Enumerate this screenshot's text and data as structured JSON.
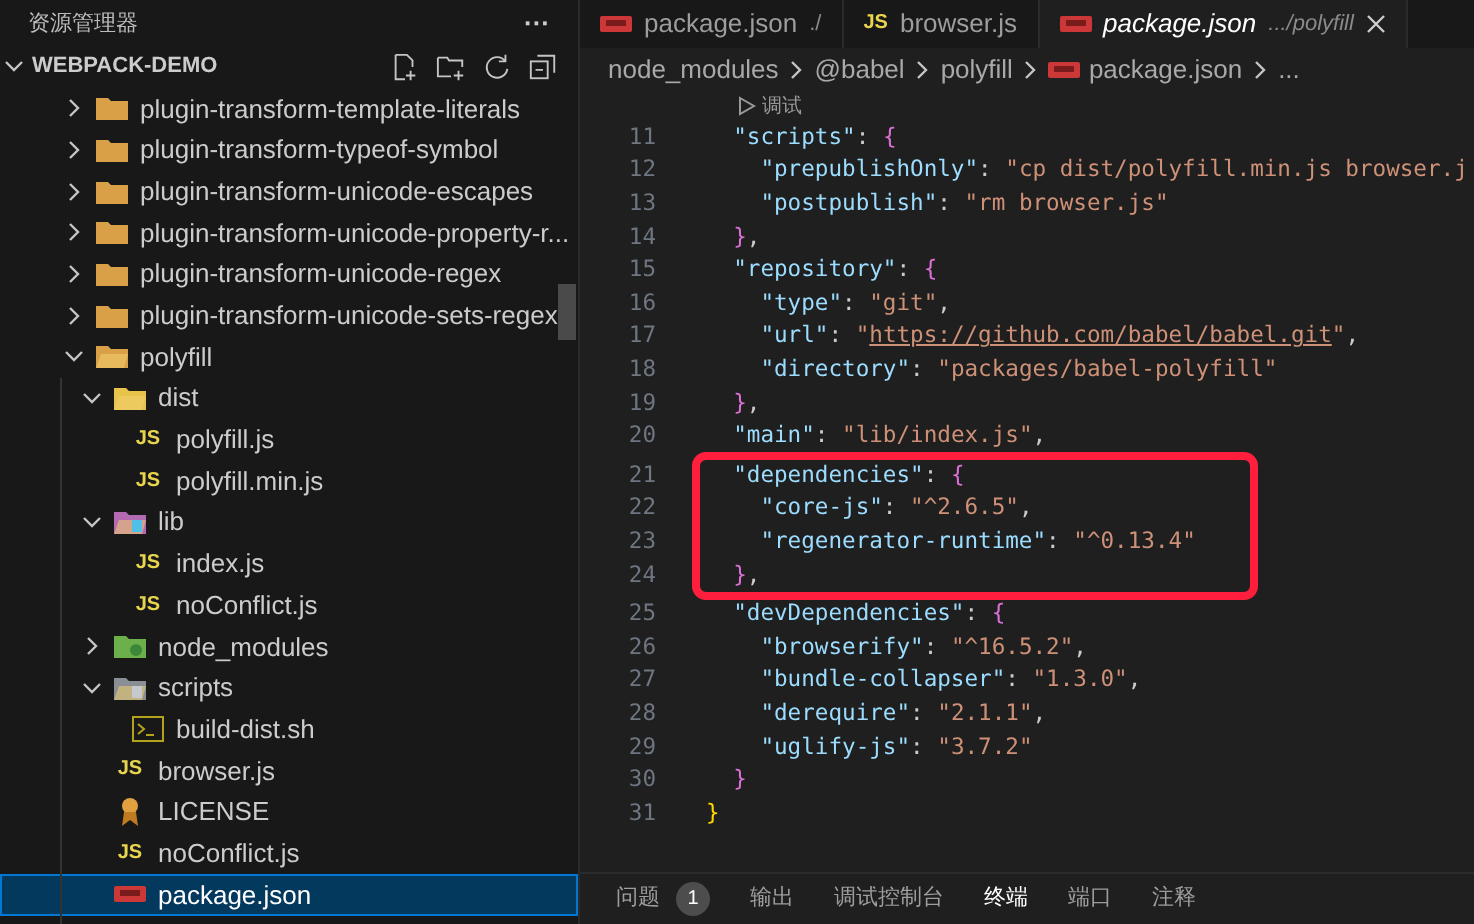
{
  "sidebar": {
    "title": "资源管理器",
    "more": "···",
    "project": {
      "name": "WEBPACK-DEMO",
      "expanded": true
    },
    "tree": [
      {
        "name": "plugin-transform-template-literals",
        "kind": "folder",
        "expanded": false,
        "selected": false
      },
      {
        "name": "plugin-transform-typeof-symbol",
        "kind": "folder",
        "expanded": false,
        "selected": false
      },
      {
        "name": "plugin-transform-unicode-escapes",
        "kind": "folder",
        "expanded": false,
        "selected": false
      },
      {
        "name": "plugin-transform-unicode-property-r...",
        "kind": "folder",
        "expanded": false,
        "selected": false
      },
      {
        "name": "plugin-transform-unicode-regex",
        "kind": "folder",
        "expanded": false,
        "selected": false
      },
      {
        "name": "plugin-transform-unicode-sets-regex",
        "kind": "folder",
        "expanded": false,
        "selected": false
      },
      {
        "name": "polyfill",
        "kind": "folder",
        "expanded": true,
        "selected": false,
        "children": [
          {
            "name": "dist",
            "kind": "dist",
            "expanded": true,
            "selected": false,
            "children": [
              {
                "name": "polyfill.js",
                "kind": "js",
                "icon_label": "JS",
                "selected": false
              },
              {
                "name": "polyfill.min.js",
                "kind": "js",
                "icon_label": "JS",
                "selected": false
              }
            ]
          },
          {
            "name": "lib",
            "kind": "lib",
            "expanded": true,
            "selected": false,
            "children": [
              {
                "name": "index.js",
                "kind": "js",
                "icon_label": "JS",
                "selected": false
              },
              {
                "name": "noConflict.js",
                "kind": "js",
                "icon_label": "JS",
                "selected": false
              }
            ]
          },
          {
            "name": "node_modules",
            "kind": "node",
            "expanded": false,
            "selected": false
          },
          {
            "name": "scripts",
            "kind": "scripts",
            "expanded": true,
            "selected": false,
            "children": [
              {
                "name": "build-dist.sh",
                "kind": "shell",
                "selected": false
              }
            ]
          },
          {
            "name": "browser.js",
            "kind": "js",
            "icon_label": "JS",
            "selected": false
          },
          {
            "name": "LICENSE",
            "kind": "license",
            "selected": false
          },
          {
            "name": "noConflict.js",
            "kind": "js",
            "icon_label": "JS",
            "selected": false
          },
          {
            "name": "package.json",
            "kind": "json",
            "selected": true
          }
        ]
      }
    ]
  },
  "tabs": [
    {
      "label": "package.json",
      "detail": "./",
      "kind": "json",
      "selected": false
    },
    {
      "label": "browser.js",
      "kind": "js",
      "icon_label": "JS",
      "selected": false
    },
    {
      "label": "package.json",
      "detail": ".../polyfill",
      "kind": "json",
      "selected": true
    }
  ],
  "breadcrumb": [
    {
      "label": "node_modules",
      "kind": "folder"
    },
    {
      "label": "@babel",
      "kind": "folder"
    },
    {
      "label": "polyfill",
      "kind": "folder"
    },
    {
      "label": "package.json",
      "kind": "json"
    },
    {
      "label": "...",
      "kind": "folder"
    }
  ],
  "codelens": "调试",
  "lines": [
    {
      "number": "11",
      "highlighted": false,
      "tokens": [
        {
          "kind": "key",
          "text": "  \"scripts\""
        },
        {
          "kind": "punct",
          "text": ": "
        },
        {
          "kind": "brace",
          "text": "{"
        }
      ]
    },
    {
      "number": "12",
      "highlighted": false,
      "tokens": [
        {
          "kind": "key",
          "text": "    \"prepublishOnly\""
        },
        {
          "kind": "punct",
          "text": ": "
        },
        {
          "kind": "string",
          "text": "\"cp dist/polyfill.min.js browser.j"
        }
      ]
    },
    {
      "number": "13",
      "highlighted": false,
      "tokens": [
        {
          "kind": "key",
          "text": "    \"postpublish\""
        },
        {
          "kind": "punct",
          "text": ": "
        },
        {
          "kind": "string",
          "text": "\"rm browser.js\""
        }
      ]
    },
    {
      "number": "14",
      "highlighted": false,
      "tokens": [
        {
          "kind": "brace",
          "text": "  }"
        },
        {
          "kind": "punct",
          "text": ","
        }
      ]
    },
    {
      "number": "15",
      "highlighted": false,
      "tokens": [
        {
          "kind": "key",
          "text": "  \"repository\""
        },
        {
          "kind": "punct",
          "text": ": "
        },
        {
          "kind": "brace",
          "text": "{"
        }
      ]
    },
    {
      "number": "16",
      "highlighted": false,
      "tokens": [
        {
          "kind": "key",
          "text": "    \"type\""
        },
        {
          "kind": "punct",
          "text": ": "
        },
        {
          "kind": "string",
          "text": "\"git\""
        },
        {
          "kind": "punct",
          "text": ","
        }
      ]
    },
    {
      "number": "17",
      "highlighted": false,
      "tokens": [
        {
          "kind": "key",
          "text": "    \"url\""
        },
        {
          "kind": "punct",
          "text": ": "
        },
        {
          "kind": "string",
          "text": "\""
        },
        {
          "kind": "link",
          "text": "https://github.com/babel/babel.git"
        },
        {
          "kind": "string",
          "text": "\""
        },
        {
          "kind": "punct",
          "text": ","
        }
      ]
    },
    {
      "number": "18",
      "highlighted": false,
      "tokens": [
        {
          "kind": "key",
          "text": "    \"directory\""
        },
        {
          "kind": "punct",
          "text": ": "
        },
        {
          "kind": "string",
          "text": "\"packages/babel-polyfill\""
        }
      ]
    },
    {
      "number": "19",
      "highlighted": false,
      "tokens": [
        {
          "kind": "brace",
          "text": "  }"
        },
        {
          "kind": "punct",
          "text": ","
        }
      ]
    },
    {
      "number": "20",
      "highlighted": false,
      "tokens": [
        {
          "kind": "key",
          "text": "  \"main\""
        },
        {
          "kind": "punct",
          "text": ": "
        },
        {
          "kind": "string",
          "text": "\"lib/index.js\""
        },
        {
          "kind": "punct",
          "text": ","
        }
      ]
    },
    {
      "number": "21",
      "highlighted": true,
      "tokens": [
        {
          "kind": "key",
          "text": "  \"dependencies\""
        },
        {
          "kind": "punct",
          "text": ": "
        },
        {
          "kind": "brace",
          "text": "{"
        }
      ]
    },
    {
      "number": "22",
      "highlighted": true,
      "tokens": [
        {
          "kind": "key",
          "text": "    \"core-js\""
        },
        {
          "kind": "punct",
          "text": ": "
        },
        {
          "kind": "string",
          "text": "\"^2.6.5\""
        },
        {
          "kind": "punct",
          "text": ","
        }
      ]
    },
    {
      "number": "23",
      "highlighted": true,
      "tokens": [
        {
          "kind": "key",
          "text": "    \"regenerator-runtime\""
        },
        {
          "kind": "punct",
          "text": ": "
        },
        {
          "kind": "string",
          "text": "\"^0.13.4\""
        }
      ]
    },
    {
      "number": "24",
      "highlighted": true,
      "tokens": [
        {
          "kind": "brace",
          "text": "  }"
        },
        {
          "kind": "punct",
          "text": ","
        }
      ]
    },
    {
      "number": "25",
      "highlighted": false,
      "tokens": [
        {
          "kind": "key",
          "text": "  \"devDependencies\""
        },
        {
          "kind": "punct",
          "text": ": "
        },
        {
          "kind": "brace",
          "text": "{"
        }
      ]
    },
    {
      "number": "26",
      "highlighted": false,
      "tokens": [
        {
          "kind": "key",
          "text": "    \"browserify\""
        },
        {
          "kind": "punct",
          "text": ": "
        },
        {
          "kind": "string",
          "text": "\"^16.5.2\""
        },
        {
          "kind": "punct",
          "text": ","
        }
      ]
    },
    {
      "number": "27",
      "highlighted": false,
      "tokens": [
        {
          "kind": "key",
          "text": "    \"bundle-collapser\""
        },
        {
          "kind": "punct",
          "text": ": "
        },
        {
          "kind": "string",
          "text": "\"1.3.0\""
        },
        {
          "kind": "punct",
          "text": ","
        }
      ]
    },
    {
      "number": "28",
      "highlighted": false,
      "tokens": [
        {
          "kind": "key",
          "text": "    \"derequire\""
        },
        {
          "kind": "punct",
          "text": ": "
        },
        {
          "kind": "string",
          "text": "\"2.1.1\""
        },
        {
          "kind": "punct",
          "text": ","
        }
      ]
    },
    {
      "number": "29",
      "highlighted": false,
      "tokens": [
        {
          "kind": "key",
          "text": "    \"uglify-js\""
        },
        {
          "kind": "punct",
          "text": ": "
        },
        {
          "kind": "string",
          "text": "\"3.7.2\""
        }
      ]
    },
    {
      "number": "30",
      "highlighted": false,
      "tokens": [
        {
          "kind": "brace",
          "text": "  }"
        }
      ]
    },
    {
      "number": "31",
      "highlighted": false,
      "tokens": [
        {
          "kind": "outer",
          "text": "}"
        }
      ]
    }
  ],
  "panel_tabs": [
    {
      "label": "问题",
      "badge": "1",
      "selected": false
    },
    {
      "label": "输出",
      "selected": false
    },
    {
      "label": "调试控制台",
      "selected": false
    },
    {
      "label": "终端",
      "selected": true
    },
    {
      "label": "端口",
      "selected": false
    },
    {
      "label": "注释",
      "selected": false
    }
  ]
}
